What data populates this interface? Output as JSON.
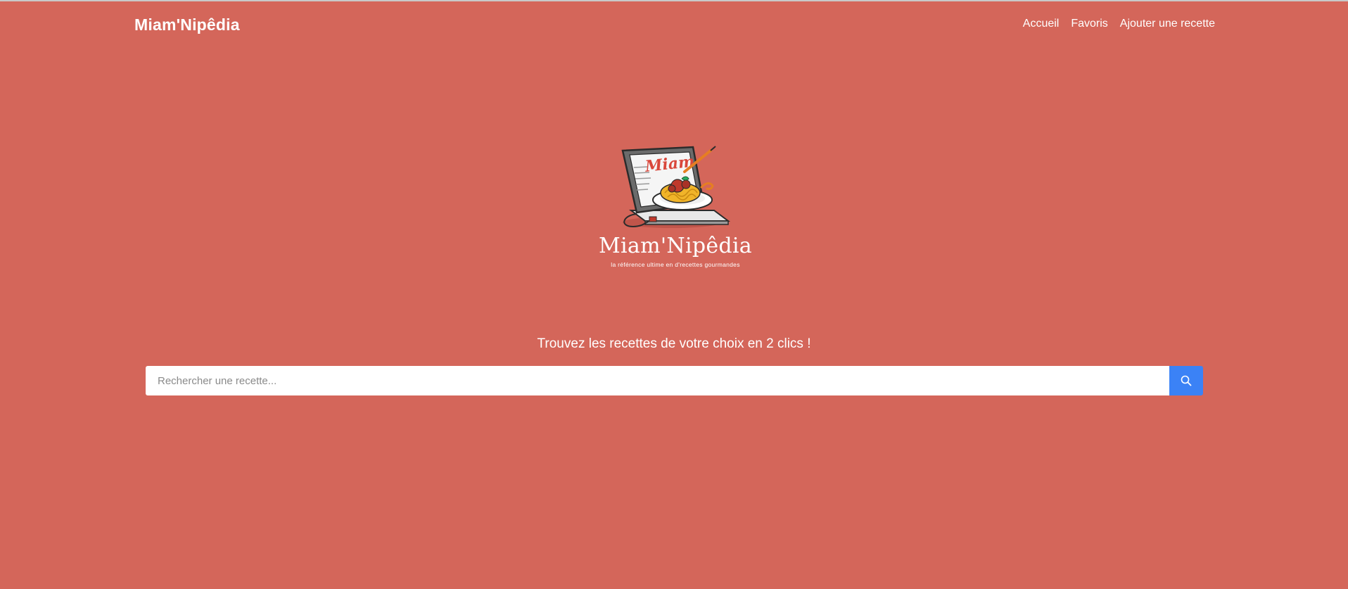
{
  "navbar": {
    "brand": "Miam'Nipêdia",
    "links": [
      {
        "label": "Accueil"
      },
      {
        "label": "Favoris"
      },
      {
        "label": "Ajouter une recette"
      }
    ]
  },
  "logo": {
    "title": "Miam'Nipêdia",
    "tagline": "la référence ultime en d'recettes gourmandes",
    "book_text": "Miam"
  },
  "hero": {
    "tagline": "Trouvez les recettes de votre choix en 2 clics !"
  },
  "search": {
    "placeholder": "Rechercher une recette...",
    "button_icon": "search-icon"
  },
  "colors": {
    "background": "#d4665a",
    "search_button": "#3b82f6",
    "text": "#ffffff"
  }
}
